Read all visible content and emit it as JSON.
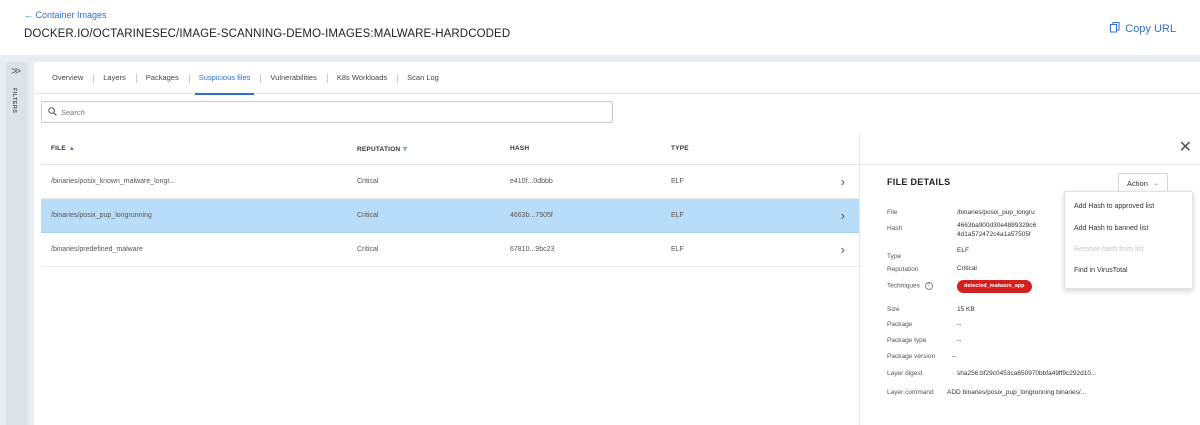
{
  "header": {
    "back_link": "← Container Images",
    "title": "DOCKER.IO/OCTARINESEC/IMAGE-SCANNING-DEMO-IMAGES:MALWARE-HARDCODED",
    "copy_url_label": "Copy URL",
    "copy_icon": "copy-icon"
  },
  "filters_rail": {
    "expand_glyph": "≫",
    "label": "FILTERS"
  },
  "tabs": [
    {
      "label": "Overview",
      "active": false
    },
    {
      "label": "Layers",
      "active": false
    },
    {
      "label": "Packages",
      "active": false
    },
    {
      "label": "Suspicious files",
      "active": true
    },
    {
      "label": "Vulnerabilities",
      "active": false
    },
    {
      "label": "K8s Workloads",
      "active": false
    },
    {
      "label": "Scan Log",
      "active": false
    }
  ],
  "search": {
    "placeholder": "Search",
    "icon": "search-icon"
  },
  "table": {
    "columns": {
      "file": "FILE",
      "reputation": "REPUTATION",
      "hash": "HASH",
      "type": "TYPE"
    },
    "rows": [
      {
        "file": "/binaries/posix_known_malware_longr...",
        "reputation": "Critical",
        "hash": "e410f...0dbbb",
        "type": "ELF",
        "selected": false
      },
      {
        "file": "/binaries/posix_pup_longrunning",
        "reputation": "Critical",
        "hash": "4663b...7505f",
        "type": "ELF",
        "selected": true
      },
      {
        "file": "/binaries/predefined_malware",
        "reputation": "Critical",
        "hash": "67810...9bc23",
        "type": "ELF",
        "selected": false
      }
    ]
  },
  "details": {
    "title": "FILE DETAILS",
    "action_label": "Action",
    "fields": {
      "file_label": "File",
      "file_value": "/binaries/posix_pup_longru",
      "hash_label": "Hash",
      "hash_line1": "4663ba900d30e4889329c6",
      "hash_line2": "4d1a572472c4a1a57505f",
      "type_label": "Type",
      "type_value": "ELF",
      "reputation_label": "Reputation",
      "reputation_value": "Critical",
      "techniques_label": "Techniques",
      "techniques_badge": "detected_malware_app",
      "size_label": "Size",
      "size_value": "15 KB",
      "package_label": "Package",
      "package_value": "--",
      "package_type_label": "Package type",
      "package_type_value": "--",
      "package_version_label": "Package version",
      "package_version_value": "--",
      "layer_digest_label": "Layer digest",
      "layer_digest_value": "sha256:bf29c0453ca650970bbfa49ff9c292d10...",
      "layer_command_label": "Layer command",
      "layer_command_value": "ADD binaries/posix_pup_longrunning binaries/..."
    }
  },
  "action_menu": {
    "items": [
      {
        "label": "Add Hash to approved list",
        "disabled": false
      },
      {
        "label": "Add Hash to banned list",
        "disabled": false
      },
      {
        "label": "Remove hash from list",
        "disabled": true
      },
      {
        "label": "Find in VirusTotal",
        "disabled": false
      }
    ]
  },
  "colors": {
    "accent": "#2f6fd1",
    "selected_row": "#b9ddf8",
    "badge_red": "#d21f1f"
  }
}
